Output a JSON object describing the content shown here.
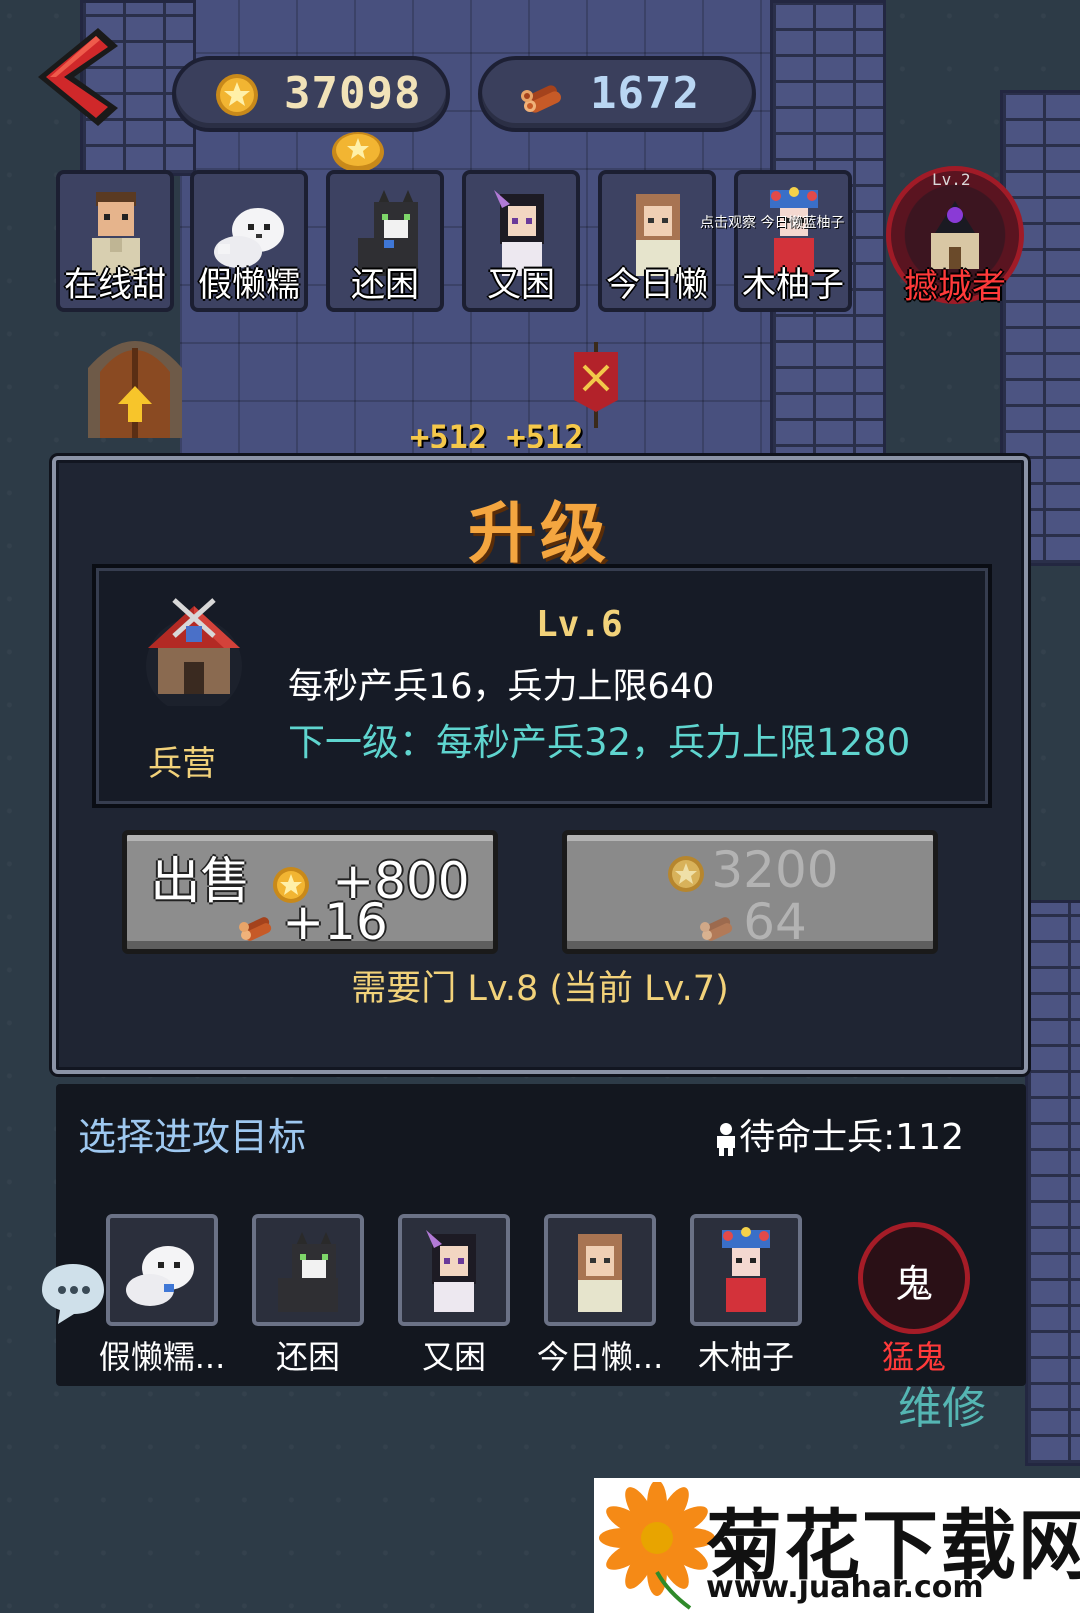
{
  "resources": {
    "coins": "37098",
    "wood": "1672"
  },
  "characters": [
    {
      "name": "在线甜",
      "icon": "man-portrait"
    },
    {
      "name": "假懒糯",
      "icon": "white-dog-portrait"
    },
    {
      "name": "还困",
      "icon": "black-cat-portrait"
    },
    {
      "name": "又困",
      "icon": "girl-portrait"
    },
    {
      "name": "今日懒",
      "icon": "woman-portrait"
    },
    {
      "name": "木柚子",
      "icon": "opera-girl-portrait"
    }
  ],
  "tooltip": "点击观察 今日懒蓝柚子",
  "boss": {
    "level": "Lv.2",
    "name": "撼城者"
  },
  "floating_gain": "+512 +512",
  "dialog": {
    "title": "升级",
    "building_name": "兵营",
    "level": "Lv.6",
    "current_stats": "每秒产兵16，兵力上限640",
    "next_stats": "下一级：每秒产兵32，兵力上限1280",
    "sell_label": "出售",
    "sell_coins": "+800",
    "sell_wood": "+16",
    "upgrade_coins": "3200",
    "upgrade_wood": "64",
    "requirement": "需要门 Lv.8 (当前 Lv.7)"
  },
  "targets": {
    "title": "选择进攻目标",
    "standby_label": "待命士兵:",
    "standby_count": "112",
    "items": [
      {
        "name": "假懒糯...",
        "icon": "white-dog-portrait"
      },
      {
        "name": "还困",
        "icon": "black-cat-portrait"
      },
      {
        "name": "又困",
        "icon": "girl-portrait"
      },
      {
        "name": "今日懒...",
        "icon": "woman-portrait"
      },
      {
        "name": "木柚子",
        "icon": "opera-girl-portrait"
      }
    ],
    "ghost": {
      "char": "鬼",
      "name": "猛鬼"
    }
  },
  "repair_label": "维修",
  "watermark": {
    "title": "菊花下载网",
    "url": "www.juahar.com"
  },
  "colors": {
    "title_orange": "#f4a640",
    "next_level_cyan": "#5fd5cf",
    "gold_text": "#f2d27a",
    "enemy_red": "#ff3a3a"
  }
}
